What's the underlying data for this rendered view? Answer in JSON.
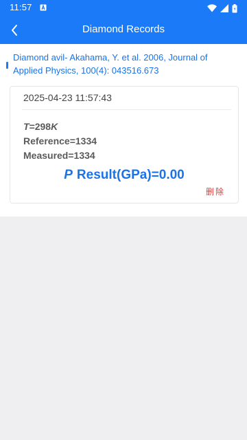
{
  "status_bar": {
    "time": "11:57",
    "icons": [
      "a-notification-icon",
      "wifi-icon",
      "signal-icon",
      "battery-icon"
    ]
  },
  "app_bar": {
    "title": "Diamond Records",
    "back_icon": "chevron-left-icon"
  },
  "source": {
    "text": "Diamond avil- Akahama, Y. et al. 2006, Journal of Applied Physics, 100(4): 043516.673"
  },
  "record": {
    "datetime": "2025-04-23 11:57:43",
    "temperature_symbol": "T",
    "temperature_value": "=298",
    "temperature_unit": "K",
    "reference": "Reference=1334",
    "measured": "Measured=1334",
    "result_symbol": "P",
    "result_text": "Result(GPa)=0.00",
    "delete_label": "删除"
  },
  "colors": {
    "primary": "#1a7af8",
    "accent_text": "#1a73e8",
    "delete": "#e53935",
    "background": "#efeff1"
  }
}
